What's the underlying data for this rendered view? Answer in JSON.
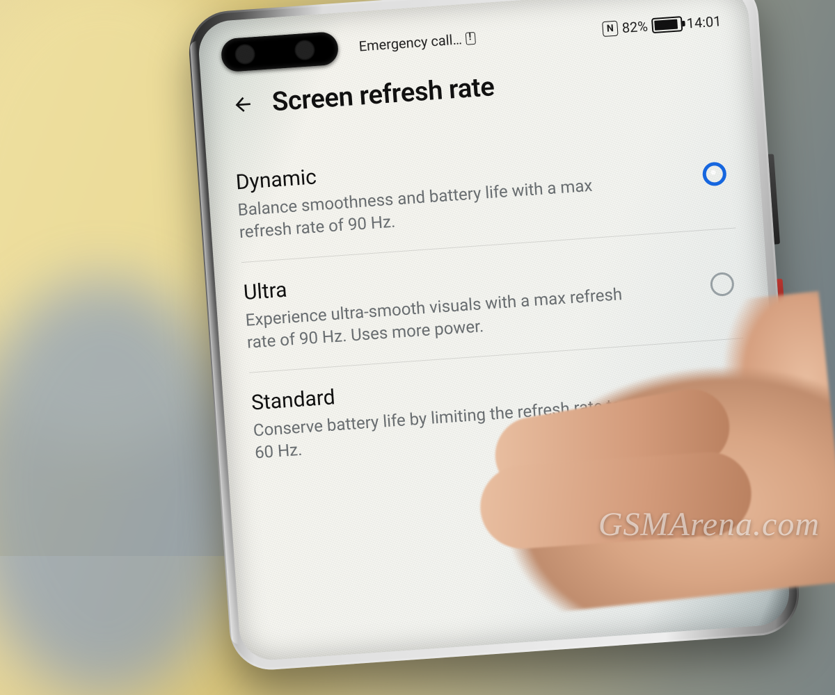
{
  "statusbar": {
    "carrier_text": "Emergency call…",
    "nfc_label": "N",
    "battery_percent": "82%",
    "clock": "14:01"
  },
  "header": {
    "title": "Screen refresh rate"
  },
  "options": [
    {
      "title": "Dynamic",
      "description": "Balance smoothness and battery life with a max refresh rate of 90 Hz.",
      "selected": true
    },
    {
      "title": "Ultra",
      "description": "Experience ultra-smooth visuals with a max refresh rate of 90 Hz. Uses more power.",
      "selected": false
    },
    {
      "title": "Standard",
      "description": "Conserve battery life by limiting the refresh rate to 60 Hz.",
      "selected": false
    }
  ],
  "watermark": "GSMArena.com"
}
